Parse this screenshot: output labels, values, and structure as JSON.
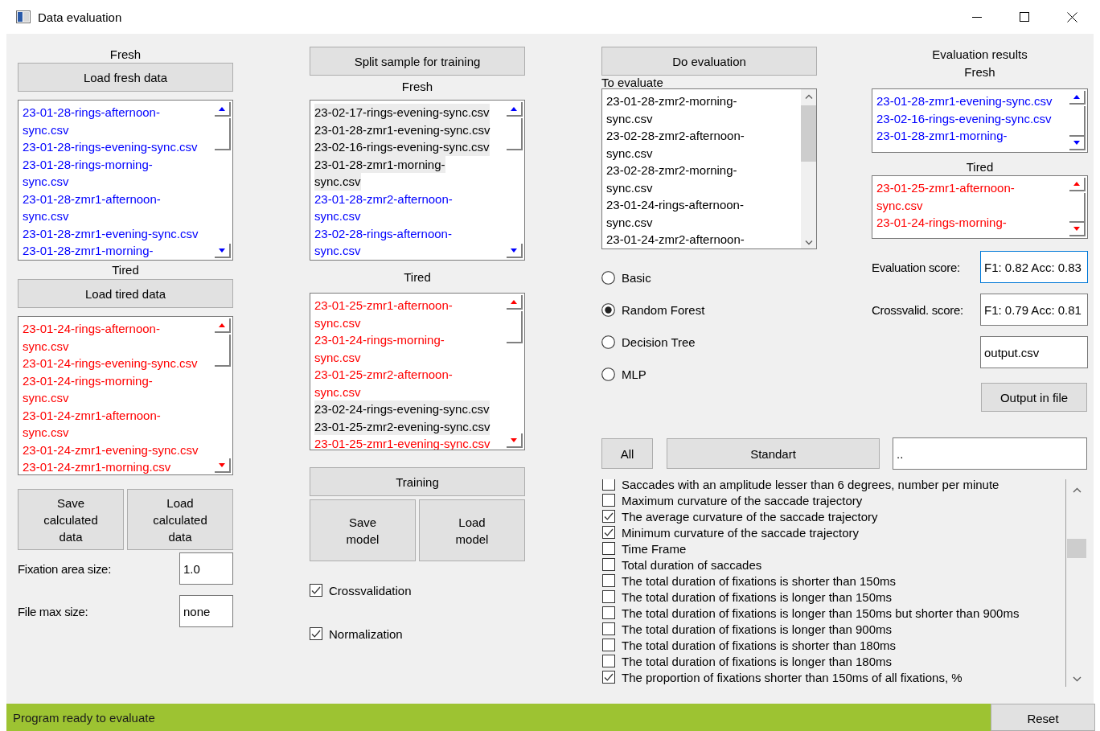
{
  "window": {
    "title": "Data evaluation"
  },
  "data_loading": {
    "sections": [
      {
        "label": "Fresh",
        "button": "Load fresh data",
        "list": {
          "items": [
            {
              "lines": [
                "23-01-28-rings-afternoon-",
                "sync.csv"
              ],
              "color": "#0000ff"
            },
            {
              "lines": [
                "23-01-28-rings-evening-sync.csv"
              ],
              "color": "#0000ff"
            },
            {
              "lines": [
                "23-01-28-rings-morning-",
                "sync.csv"
              ],
              "color": "#0000ff"
            },
            {
              "lines": [
                "23-01-28-zmr1-afternoon-",
                "sync.csv"
              ],
              "color": "#0000ff"
            },
            {
              "lines": [
                "23-01-28-zmr1-evening-sync.csv"
              ],
              "color": "#0000ff"
            },
            {
              "lines": [
                "23-01-28-zmr1-morning-"
              ],
              "color": "#0000ff"
            }
          ]
        }
      },
      {
        "label": "Tired",
        "button": "Load tired data",
        "list": {
          "items": [
            {
              "lines": [
                "23-01-24-rings-afternoon-",
                "sync.csv"
              ],
              "color": "#ff0000"
            },
            {
              "lines": [
                "23-01-24-rings-evening-sync.csv"
              ],
              "color": "#ff0000"
            },
            {
              "lines": [
                "23-01-24-rings-morning-",
                "sync.csv"
              ],
              "color": "#ff0000"
            },
            {
              "lines": [
                "23-01-24-zmr1-afternoon-",
                "sync.csv"
              ],
              "color": "#ff0000"
            },
            {
              "lines": [
                "23-01-24-zmr1-evening-sync.csv"
              ],
              "color": "#ff0000"
            },
            {
              "lines": [
                "23-01-24-zmr1-morning.csv"
              ],
              "color": "#ff0000"
            }
          ]
        }
      }
    ],
    "buttons": [
      [
        "Save",
        "calculated",
        "data"
      ],
      [
        "Load",
        "calculated",
        "data"
      ]
    ],
    "fields": [
      {
        "label": "Fixation area size:",
        "value": "1.0"
      },
      {
        "label": "File max size:",
        "value": "none"
      }
    ]
  },
  "training": {
    "button": "Split sample for training",
    "sections": [
      {
        "label": "Fresh",
        "list": {
          "items": [
            {
              "lines": [
                "23-02-17-rings-evening-sync.csv"
              ],
              "color": "#000000",
              "selected": true
            },
            {
              "lines": [
                "23-01-28-zmr1-evening-sync.csv"
              ],
              "color": "#000000",
              "selected": true
            },
            {
              "lines": [
                "23-02-16-rings-evening-sync.csv"
              ],
              "color": "#000000",
              "selected": true
            },
            {
              "lines": [
                "23-01-28-zmr1-morning-",
                "sync.csv"
              ],
              "color": "#000000",
              "selected": true
            },
            {
              "lines": [
                "23-01-28-zmr2-afternoon-",
                "sync.csv"
              ],
              "color": "#0000ff",
              "selected": false
            },
            {
              "lines": [
                "23-02-28-rings-afternoon-",
                "sync.csv"
              ],
              "color": "#0000ff",
              "selected": false
            }
          ]
        }
      },
      {
        "label": "Tired",
        "list": {
          "items": [
            {
              "lines": [
                "23-01-25-zmr1-afternoon-",
                "sync.csv"
              ],
              "color": "#ff0000",
              "selected": false
            },
            {
              "lines": [
                "23-01-24-rings-morning-",
                "sync.csv"
              ],
              "color": "#ff0000",
              "selected": false
            },
            {
              "lines": [
                "23-01-25-zmr2-afternoon-",
                "sync.csv"
              ],
              "color": "#ff0000",
              "selected": false
            },
            {
              "lines": [
                "23-02-24-rings-evening-sync.csv"
              ],
              "color": "#000000",
              "selected": true
            },
            {
              "lines": [
                "23-01-25-zmr2-evening-sync.csv"
              ],
              "color": "#000000",
              "selected": true
            },
            {
              "lines": [
                "23-01-25-zmr1-evening-sync.csv"
              ],
              "color": "#ff0000",
              "selected": false
            }
          ]
        }
      }
    ],
    "train_button": "Training",
    "model_buttons": [
      [
        "Save",
        "model"
      ],
      [
        "Load",
        "model"
      ]
    ],
    "options": [
      {
        "label": "Crossvalidation",
        "checked": true
      },
      {
        "label": "Normalization",
        "checked": true
      }
    ]
  },
  "evaluation": {
    "button": "Do evaluation",
    "list_label": "To evaluate",
    "list": {
      "items": [
        {
          "lines": [
            "23-01-28-zmr2-morning-",
            "sync.csv"
          ],
          "color": "#000000"
        },
        {
          "lines": [
            "23-02-28-zmr2-afternoon-",
            "sync.csv"
          ],
          "color": "#000000"
        },
        {
          "lines": [
            "23-02-28-zmr2-morning-",
            "sync.csv"
          ],
          "color": "#000000"
        },
        {
          "lines": [
            "23-01-24-rings-afternoon-",
            "sync.csv"
          ],
          "color": "#000000"
        },
        {
          "lines": [
            "23-01-24-zmr2-afternoon-"
          ],
          "color": "#000000"
        }
      ]
    },
    "models": [
      {
        "label": "Basic",
        "selected": false
      },
      {
        "label": "Random Forest",
        "selected": true
      },
      {
        "label": "Decision Tree",
        "selected": false
      },
      {
        "label": "MLP",
        "selected": false
      }
    ]
  },
  "results": {
    "title": "Evaluation results",
    "sections": [
      {
        "label": "Fresh",
        "list": {
          "items": [
            {
              "lines": [
                "23-01-28-zmr1-evening-sync.csv"
              ],
              "color": "#0000ff"
            },
            {
              "lines": [
                "23-02-16-rings-evening-sync.csv"
              ],
              "color": "#0000ff"
            },
            {
              "lines": [
                "23-01-28-zmr1-morning-"
              ],
              "color": "#0000ff"
            }
          ]
        }
      },
      {
        "label": "Tired",
        "list": {
          "items": [
            {
              "lines": [
                "23-01-25-zmr1-afternoon-",
                "sync.csv"
              ],
              "color": "#ff0000"
            },
            {
              "lines": [
                "23-01-24-rings-morning-"
              ],
              "color": "#ff0000"
            }
          ]
        }
      }
    ],
    "scores": [
      {
        "label": "Evaluation score:",
        "value": "F1: 0.82 Acc: 0.83",
        "focused": true
      },
      {
        "label": "Crossvalid. score:",
        "value": "F1: 0.79 Acc: 0.81",
        "focused": false
      }
    ],
    "output_field": {
      "value": "output.csv"
    },
    "output_button": "Output in file"
  },
  "features": {
    "buttons": [
      "All",
      "Standart"
    ],
    "path_field": {
      "value": ".."
    },
    "items": [
      {
        "label": "Saccades with an amplitude lesser than 6 degrees, number per minute",
        "checked": false
      },
      {
        "label": "Maximum curvature of the saccade trajectory",
        "checked": false
      },
      {
        "label": "The average curvature of the saccade trajectory",
        "checked": true
      },
      {
        "label": "Minimum curvature of the saccade trajectory",
        "checked": true
      },
      {
        "label": "Time Frame",
        "checked": false
      },
      {
        "label": "Total duration of saccades",
        "checked": false
      },
      {
        "label": "The total duration of fixations is shorter than 150ms",
        "checked": false
      },
      {
        "label": "The total duration of fixations is longer than 150ms",
        "checked": false
      },
      {
        "label": "The total duration of fixations is longer than 150ms but shorter than 900ms",
        "checked": false
      },
      {
        "label": "The total duration of fixations is longer than 900ms",
        "checked": false
      },
      {
        "label": "The total duration of fixations is shorter than 180ms",
        "checked": false
      },
      {
        "label": "The total duration of fixations is longer than 180ms",
        "checked": false
      },
      {
        "label": "The proportion of fixations shorter than 150ms of all fixations, %",
        "checked": true
      }
    ]
  },
  "status_bar": {
    "text": "Program ready to evaluate",
    "button": "Reset"
  }
}
